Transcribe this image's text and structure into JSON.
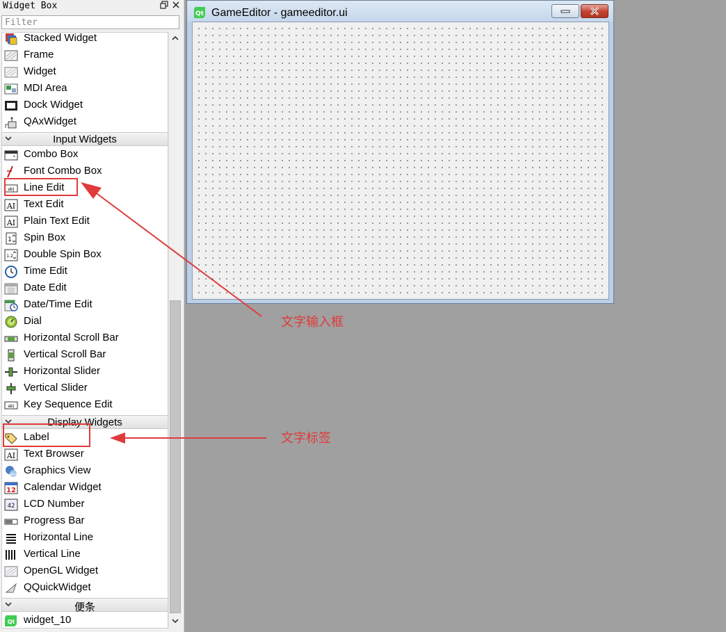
{
  "widget_box": {
    "title": "Widget Box",
    "filter_placeholder": "Filter",
    "rows": [
      {
        "kind": "item",
        "label": "Stacked Widget",
        "icon": "stacked-widget-icon"
      },
      {
        "kind": "item",
        "label": "Frame",
        "icon": "frame-icon"
      },
      {
        "kind": "item",
        "label": "Widget",
        "icon": "widget-icon"
      },
      {
        "kind": "item",
        "label": "MDI Area",
        "icon": "mdi-area-icon"
      },
      {
        "kind": "item",
        "label": "Dock Widget",
        "icon": "dock-widget-icon"
      },
      {
        "kind": "item",
        "label": "QAxWidget",
        "icon": "qaxwidget-icon"
      },
      {
        "kind": "category",
        "label": "Input Widgets"
      },
      {
        "kind": "item",
        "label": "Combo Box",
        "icon": "combo-box-icon"
      },
      {
        "kind": "item",
        "label": "Font Combo Box",
        "icon": "font-combo-box-icon"
      },
      {
        "kind": "item",
        "label": "Line Edit",
        "icon": "line-edit-icon"
      },
      {
        "kind": "item",
        "label": "Text Edit",
        "icon": "text-edit-icon"
      },
      {
        "kind": "item",
        "label": "Plain Text Edit",
        "icon": "plain-text-edit-icon"
      },
      {
        "kind": "item",
        "label": "Spin Box",
        "icon": "spin-box-icon"
      },
      {
        "kind": "item",
        "label": "Double Spin Box",
        "icon": "double-spin-box-icon"
      },
      {
        "kind": "item",
        "label": "Time Edit",
        "icon": "time-edit-icon"
      },
      {
        "kind": "item",
        "label": "Date Edit",
        "icon": "date-edit-icon"
      },
      {
        "kind": "item",
        "label": "Date/Time Edit",
        "icon": "datetime-edit-icon"
      },
      {
        "kind": "item",
        "label": "Dial",
        "icon": "dial-icon"
      },
      {
        "kind": "item",
        "label": "Horizontal Scroll Bar",
        "icon": "horizontal-scroll-bar-icon"
      },
      {
        "kind": "item",
        "label": "Vertical Scroll Bar",
        "icon": "vertical-scroll-bar-icon"
      },
      {
        "kind": "item",
        "label": "Horizontal Slider",
        "icon": "horizontal-slider-icon"
      },
      {
        "kind": "item",
        "label": "Vertical Slider",
        "icon": "vertical-slider-icon"
      },
      {
        "kind": "item",
        "label": "Key Sequence Edit",
        "icon": "key-sequence-edit-icon"
      },
      {
        "kind": "category",
        "label": "Display Widgets"
      },
      {
        "kind": "item",
        "label": "Label",
        "icon": "label-icon"
      },
      {
        "kind": "item",
        "label": "Text Browser",
        "icon": "text-browser-icon"
      },
      {
        "kind": "item",
        "label": "Graphics View",
        "icon": "graphics-view-icon"
      },
      {
        "kind": "item",
        "label": "Calendar Widget",
        "icon": "calendar-widget-icon"
      },
      {
        "kind": "item",
        "label": "LCD Number",
        "icon": "lcd-number-icon"
      },
      {
        "kind": "item",
        "label": "Progress Bar",
        "icon": "progress-bar-icon"
      },
      {
        "kind": "item",
        "label": "Horizontal Line",
        "icon": "horizontal-line-icon"
      },
      {
        "kind": "item",
        "label": "Vertical Line",
        "icon": "vertical-line-icon"
      },
      {
        "kind": "item",
        "label": "OpenGL Widget",
        "icon": "opengl-widget-icon"
      },
      {
        "kind": "item",
        "label": "QQuickWidget",
        "icon": "qquickwidget-icon"
      },
      {
        "kind": "category",
        "label": "便条"
      },
      {
        "kind": "item",
        "label": "widget_10",
        "icon": "qt-logo-icon"
      }
    ]
  },
  "form_window": {
    "title": "GameEditor - gameeditor.ui"
  },
  "annotations": {
    "line_edit_note": "文字输入框",
    "label_note": "文字标签"
  },
  "colors": {
    "annotation": "#e03a3a",
    "canvas_bg": "#f0f0f0",
    "desktop_bg": "#a0a0a0"
  }
}
